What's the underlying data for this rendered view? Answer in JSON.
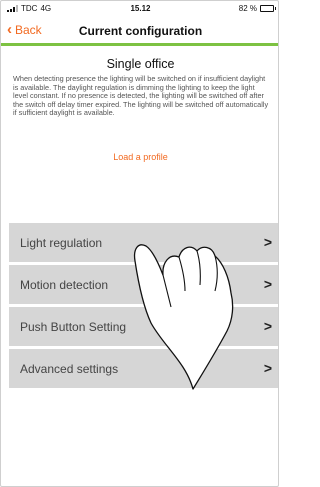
{
  "status_bar": {
    "carrier": "TDC",
    "network": "4G",
    "time": "15.12",
    "battery": "82 %",
    "battery_level": 0.82
  },
  "nav": {
    "back_label": "Back",
    "back_icon": "chevron-left-icon",
    "title": "Current configuration"
  },
  "accent_colors": {
    "orange": "#f26a21",
    "green": "#7dc242"
  },
  "page": {
    "title": "Single office",
    "description": "When detecting presence the lighting will be switched on if insufficient daylight is available. The daylight regulation is dimming the lighting to keep the light level constant. If no presence is detected, the lighting will be switched off after the switch off delay timer expired. The lighting will be switched off automatically if sufficient daylight is available.",
    "load_profile": "Load a profile"
  },
  "menu": {
    "items": [
      {
        "label": "Light regulation"
      },
      {
        "label": "Motion detection"
      },
      {
        "label": "Push Button Setting"
      },
      {
        "label": "Advanced settings"
      }
    ],
    "arrow": ">"
  },
  "overlay": {
    "icon": "pointing-hand-icon"
  }
}
